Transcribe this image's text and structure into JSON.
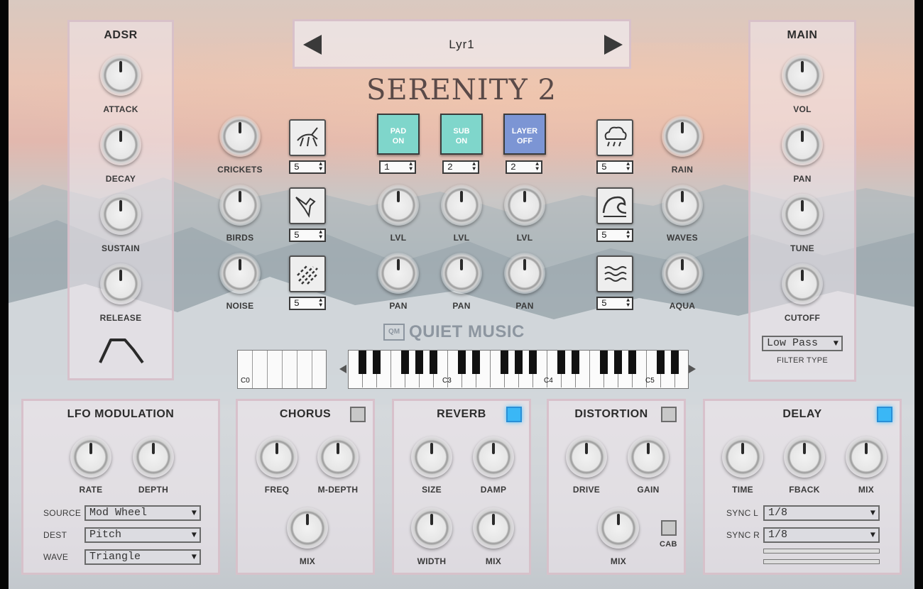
{
  "app": {
    "title": "SERENITY 2",
    "brand": "QUIET MUSIC",
    "brand_badge": "QM"
  },
  "preset": {
    "name": "Lyr1",
    "prev_icon": "triangle-left-icon",
    "next_icon": "triangle-right-icon"
  },
  "adsr": {
    "title": "ADSR",
    "knobs": [
      "ATTACK",
      "DECAY",
      "SUSTAIN",
      "RELEASE"
    ],
    "envelope_icon": "adsr-envelope-icon"
  },
  "main": {
    "title": "MAIN",
    "knobs": [
      "VOL",
      "PAN",
      "TUNE",
      "CUTOFF"
    ],
    "filter_type_label": "FILTER TYPE",
    "filter_type_value": "Low Pass"
  },
  "ambience_left": [
    {
      "knob": "CRICKETS",
      "icon": "cricket-icon",
      "value": "5"
    },
    {
      "knob": "BIRDS",
      "icon": "hummingbird-icon",
      "value": "5"
    },
    {
      "knob": "NOISE",
      "icon": "noise-lines-icon",
      "value": "5"
    }
  ],
  "ambience_right": [
    {
      "knob": "RAIN",
      "icon": "rain-cloud-icon",
      "value": "5"
    },
    {
      "knob": "WAVES",
      "icon": "ocean-wave-icon",
      "value": "5"
    },
    {
      "knob": "AQUA",
      "icon": "water-lines-icon",
      "value": "5"
    }
  ],
  "layers": [
    {
      "line1": "PAD",
      "line2": "ON",
      "color": "#7fd6cb",
      "value": "1",
      "lvl": "LVL",
      "pan": "PAN"
    },
    {
      "line1": "SUB",
      "line2": "ON",
      "color": "#7fd6cb",
      "value": "2",
      "lvl": "LVL",
      "pan": "PAN"
    },
    {
      "line1": "LAYER",
      "line2": "OFF",
      "color": "#7c95d4",
      "value": "2",
      "lvl": "LVL",
      "pan": "PAN"
    }
  ],
  "keyboard": {
    "left_label": "C0",
    "octave_labels": [
      "C3",
      "C4",
      "C5"
    ],
    "left_arrow": "triangle-left-icon",
    "right_arrow": "triangle-right-icon"
  },
  "lfo": {
    "title": "LFO MODULATION",
    "knobs": [
      "RATE",
      "DEPTH"
    ],
    "rows": [
      {
        "label": "SOURCE",
        "value": "Mod Wheel"
      },
      {
        "label": "DEST",
        "value": "Pitch"
      },
      {
        "label": "WAVE",
        "value": "Triangle"
      }
    ]
  },
  "chorus": {
    "title": "CHORUS",
    "knobs": [
      "FREQ",
      "M-DEPTH",
      "MIX"
    ],
    "enabled": false
  },
  "reverb": {
    "title": "REVERB",
    "knobs": [
      "SIZE",
      "DAMP",
      "WIDTH",
      "MIX"
    ],
    "enabled": true
  },
  "distortion": {
    "title": "DISTORTION",
    "knobs": [
      "DRIVE",
      "GAIN",
      "MIX"
    ],
    "cab_label": "CAB",
    "enabled": false
  },
  "delay": {
    "title": "DELAY",
    "knobs": [
      "TIME",
      "FBACK",
      "MIX"
    ],
    "enabled": true,
    "rows": [
      {
        "label": "SYNC L",
        "value": "1/8"
      },
      {
        "label": "SYNC R",
        "value": "1/8"
      }
    ]
  },
  "colors": {
    "toggle_on": "#3ab7f6",
    "layer_on": "#7fd6cb",
    "layer_off": "#7c95d4"
  }
}
